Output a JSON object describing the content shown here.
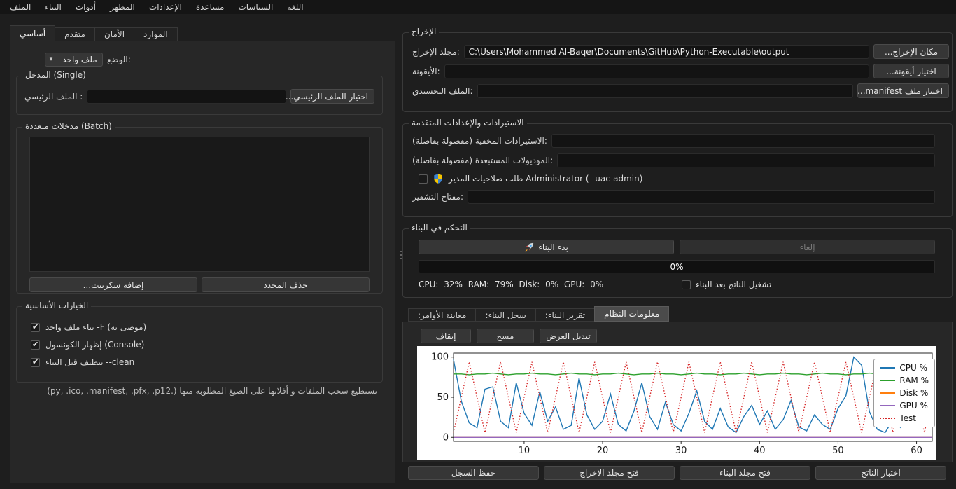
{
  "menu": {
    "items": [
      "الملف",
      "البناء",
      "أدوات",
      "المظهر",
      "الإعدادات",
      "مساعدة",
      "السياسات",
      "اللغة"
    ]
  },
  "left_panel": {
    "tabs": [
      "أساسي",
      "متقدم",
      "الأمان",
      "الموارد"
    ],
    "selected_tab": "أساسي",
    "mode": {
      "label": "الوضع:",
      "value": "ملف واحد"
    },
    "single_group": {
      "title": "المدخل (Single)",
      "main_file_label": "الملف الرئيسي :",
      "main_file_value": "",
      "choose_main_button": "اختيار الملف الرئيسي..."
    },
    "batch_group": {
      "title": "مدخلات متعددة (Batch)",
      "add_script_button": "إضافة سكريبت...",
      "remove_selected_button": "حذف المحدد"
    },
    "options_group": {
      "title": "الخيارات الأساسية",
      "checkboxes": [
        {
          "label": "بناء ملف واحد -F (موصى به)",
          "checked": true
        },
        {
          "label": "إظهار الكونسول (Console)",
          "checked": true
        },
        {
          "label": "تنظيف قبل البناء --clean",
          "checked": true
        }
      ]
    },
    "hint": "تستطيع سحب الملفات و أفلاتها على الصيغ المطلوبة منها (.py, .ico, .manifest, .pfx, .p12)"
  },
  "output_group": {
    "title": "الإخراج",
    "rows": [
      {
        "label": "مجلد الإخراج:",
        "value": "C:\\Users\\Mohammed Al-Baqer\\Documents\\GitHub\\Python-Executable\\output",
        "button": "مكان الإخراج..."
      },
      {
        "label": "الأيقونة:",
        "value": "",
        "button": "اختيار أيقونة..."
      },
      {
        "label": "الملف التجسيدي:",
        "value": "",
        "button": "اختيار ملف manifest..."
      }
    ]
  },
  "advanced_group": {
    "title": "الاستيرادات والإعدادات المتقدمة",
    "hidden_imports_label": "الاستيرادات المخفية (مفصولة بفاصلة):",
    "hidden_imports_value": "",
    "excluded_modules_label": "الموديولات المستبعدة (مفصولة بفاصلة):",
    "excluded_modules_value": "",
    "uac_label": "طلب صلاحيات المدير Administrator (--uac-admin)",
    "uac_checked": false,
    "key_label": "مفتاح التشفير:",
    "key_value": ""
  },
  "build_group": {
    "title": "التحكم في البناء",
    "start_button": "بدء البناء",
    "cancel_button": "إلغاء",
    "progress": "0%",
    "stats": "CPU: 32% RAM: 79% Disk: 0% GPU: 0%",
    "run_after_label": "تشغيل الناتج بعد البناء",
    "run_after_checked": false
  },
  "bottom_tabs": {
    "tabs": [
      "معاينة الأوامر:",
      "سجل البناء:",
      "تقرير البناء:",
      "معلومات النظام"
    ],
    "selected_tab": "معلومات النظام",
    "stop_button": "إيقاف",
    "clear_button": "مسح",
    "toggle_view_button": "تبديل العرض"
  },
  "bottom_buttons": [
    "حفظ السجل",
    "فتح مجلد الاخراج",
    "فتح مجلد البناء",
    "اختبار الناتج"
  ],
  "icons": {
    "start_build": "rocket-icon",
    "uac": "uac-shield-icon",
    "mode_combo": "chevron-down-icon",
    "checkbox": "check-icon",
    "splitter": "drag-handle-dots"
  },
  "colors": {
    "cpu": "#1f77b4",
    "ram": "#2ca02c",
    "disk": "#ff7f0e",
    "gpu": "#9467bd",
    "test": "#d62728",
    "window": "#1e1e1e",
    "panel": "#272727",
    "field": "#131313"
  },
  "chart_data": {
    "type": "line",
    "title": "",
    "xlabel": "",
    "ylabel": "",
    "xlim": [
      1,
      62
    ],
    "ylim": [
      -5,
      105
    ],
    "xticks": [
      10,
      20,
      30,
      40,
      50,
      60
    ],
    "yticks": [
      0,
      50,
      100
    ],
    "grid": false,
    "legend_position": "upper right",
    "x_start": 1,
    "x_step": 1,
    "series": [
      {
        "name": "CPU %",
        "color": "#1f77b4",
        "style": "solid",
        "values": [
          97,
          45,
          18,
          12,
          60,
          63,
          20,
          12,
          68,
          30,
          15,
          57,
          20,
          38,
          10,
          15,
          74,
          28,
          10,
          20,
          54,
          16,
          8,
          33,
          68,
          26,
          10,
          44,
          16,
          8,
          30,
          58,
          20,
          10,
          36,
          13,
          6,
          26,
          40,
          16,
          33,
          10,
          22,
          46,
          13,
          8,
          28,
          16,
          10,
          36,
          52,
          100,
          90,
          32,
          10,
          6,
          22,
          12,
          38,
          36,
          70,
          42
        ]
      },
      {
        "name": "RAM %",
        "color": "#2ca02c",
        "style": "solid",
        "values": [
          79,
          79,
          78,
          79,
          79,
          80,
          79,
          78,
          79,
          79,
          80,
          79,
          79,
          78,
          79,
          80,
          79,
          79,
          78,
          79,
          79,
          80,
          79,
          78,
          79,
          79,
          80,
          79,
          79,
          78,
          79,
          80,
          79,
          79,
          78,
          79,
          79,
          80,
          79,
          78,
          79,
          79,
          80,
          79,
          79,
          78,
          79,
          80,
          79,
          79,
          78,
          79,
          79,
          80,
          79,
          78,
          79,
          79,
          80,
          79,
          79,
          78
        ]
      },
      {
        "name": "Disk %",
        "color": "#ff7f0e",
        "style": "solid",
        "values": [
          0,
          0,
          0,
          0,
          0,
          0,
          0,
          0,
          0,
          0,
          0,
          0,
          0,
          0,
          0,
          0,
          0,
          0,
          0,
          0,
          0,
          0,
          0,
          0,
          0,
          0,
          0,
          0,
          0,
          0,
          0,
          0,
          0,
          0,
          0,
          0,
          0,
          0,
          0,
          0,
          0,
          0,
          0,
          0,
          0,
          0,
          0,
          0,
          0,
          0,
          0,
          0,
          0,
          0,
          0,
          0,
          0,
          0,
          0,
          0,
          0,
          0
        ]
      },
      {
        "name": "GPU %",
        "color": "#9467bd",
        "style": "solid",
        "values": [
          0,
          0,
          0,
          0,
          0,
          0,
          0,
          0,
          0,
          0,
          0,
          0,
          0,
          0,
          0,
          0,
          0,
          0,
          0,
          0,
          0,
          0,
          0,
          0,
          0,
          0,
          0,
          0,
          0,
          0,
          0,
          0,
          0,
          0,
          0,
          0,
          0,
          0,
          0,
          0,
          0,
          0,
          0,
          0,
          0,
          0,
          0,
          0,
          0,
          0,
          0,
          0,
          0,
          0,
          0,
          0,
          0,
          0,
          0,
          0,
          0,
          0
        ]
      },
      {
        "name": "Test",
        "color": "#d62728",
        "style": "dotted",
        "values": [
          6,
          50,
          94,
          50,
          6,
          50,
          94,
          50,
          6,
          50,
          94,
          50,
          6,
          50,
          94,
          50,
          6,
          50,
          94,
          50,
          6,
          50,
          94,
          50,
          6,
          50,
          94,
          50,
          6,
          50,
          94,
          50,
          6,
          50,
          94,
          50,
          6,
          50,
          94,
          50,
          6,
          50,
          94,
          50,
          6,
          50,
          94,
          50,
          6,
          50,
          94,
          50,
          6,
          50,
          94,
          50,
          6,
          50,
          94,
          50,
          6,
          50
        ]
      }
    ]
  }
}
